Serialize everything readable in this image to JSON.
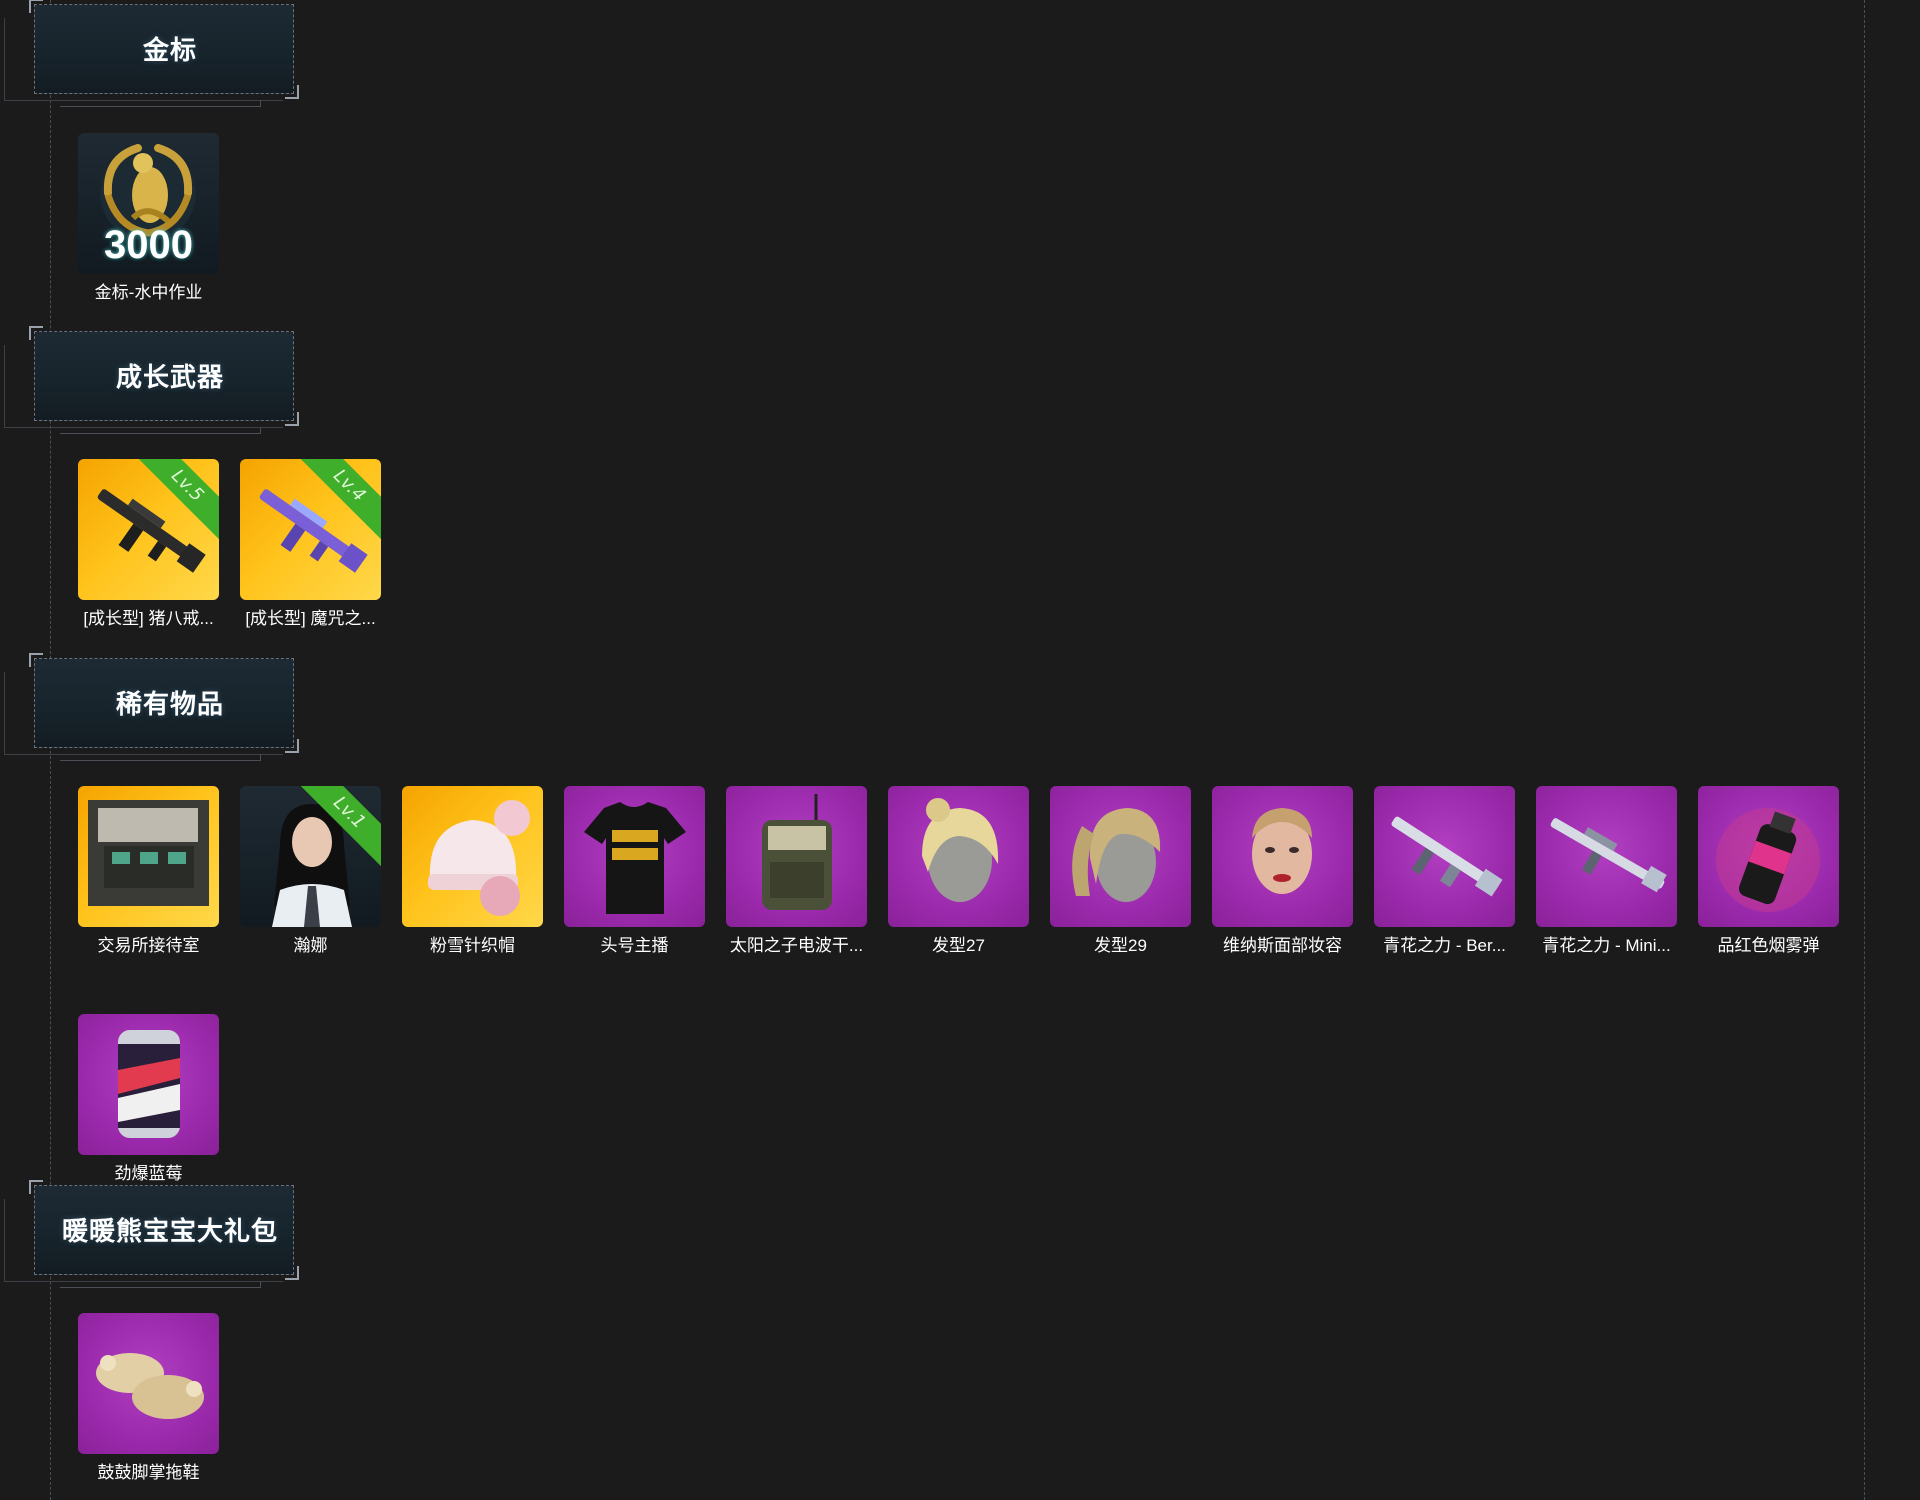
{
  "sections": [
    {
      "title": "金标",
      "items": [
        {
          "label": "金标-水中作业",
          "amount": "3000",
          "rarity": "dark",
          "icon": "gold-wreath-seal-icon"
        }
      ]
    },
    {
      "title": "成长武器",
      "items": [
        {
          "label": "[成长型] 猪八戒...",
          "rarity": "gold",
          "level": "Lv.5",
          "icon": "rifle-icon"
        },
        {
          "label": "[成长型] 魔咒之...",
          "rarity": "gold",
          "level": "Lv.4",
          "icon": "rifle-icon"
        }
      ]
    },
    {
      "title": "稀有物品",
      "items": [
        {
          "label": "交易所接待室",
          "rarity": "gold",
          "icon": "room-icon"
        },
        {
          "label": "瀚娜",
          "rarity": "dark",
          "level": "Lv.1",
          "icon": "character-icon"
        },
        {
          "label": "粉雪针织帽",
          "rarity": "gold",
          "icon": "knit-hat-icon"
        },
        {
          "label": "头号主播",
          "rarity": "purple",
          "icon": "tshirt-icon"
        },
        {
          "label": "太阳之子电波干...",
          "rarity": "purple",
          "icon": "backpack-icon"
        },
        {
          "label": "发型27",
          "rarity": "purple",
          "icon": "hairstyle-icon"
        },
        {
          "label": "发型29",
          "rarity": "purple",
          "icon": "hairstyle-icon"
        },
        {
          "label": "维纳斯面部妆容",
          "rarity": "purple",
          "icon": "face-makeup-icon"
        },
        {
          "label": "青花之力 - Ber...",
          "rarity": "purple",
          "icon": "rifle-icon"
        },
        {
          "label": "青花之力 - Mini...",
          "rarity": "purple",
          "icon": "rifle-icon"
        },
        {
          "label": "品红色烟雾弹",
          "rarity": "purple",
          "icon": "smoke-grenade-icon"
        },
        {
          "label": "劲爆蓝莓",
          "rarity": "purple",
          "icon": "drink-can-icon"
        }
      ]
    },
    {
      "title": "暖暖熊宝宝大礼包",
      "items": [
        {
          "label": "鼓鼓脚掌拖鞋",
          "rarity": "purple",
          "icon": "slippers-icon"
        }
      ]
    }
  ],
  "colors": {
    "gold": "#ffc21a",
    "purple": "#9b2aac",
    "level_badge": "#3fae2a",
    "background": "#1b1b1c"
  }
}
